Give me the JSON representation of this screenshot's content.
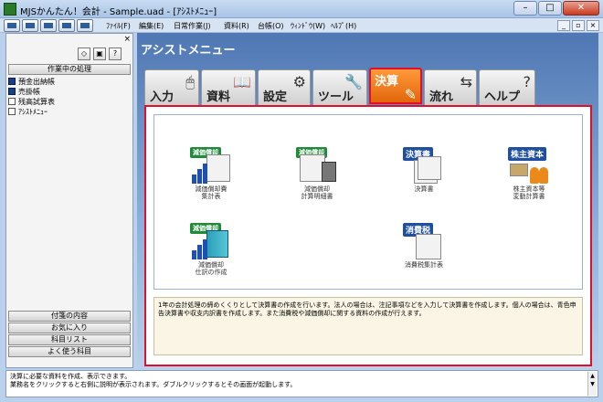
{
  "window": {
    "title": "MJSかんたん！会計 - Sample.uad - [ｱｼｽﾄﾒﾆｭｰ]",
    "minimize": "–",
    "maximize": "□",
    "close": "✕"
  },
  "menubar": {
    "items": [
      "ﾌｧｲﾙ(F)",
      "編集(E)",
      "日常作業(J)",
      "資料(R)",
      "台帳(O)",
      "ｳｨﾝﾄﾞｳ(W)",
      "ﾍﾙﾌﾟ(H)"
    ],
    "mdi": [
      "_",
      "▫",
      "×"
    ]
  },
  "left_pane": {
    "close": "×",
    "icon_buttons": [
      "◇",
      "▣",
      "?"
    ],
    "section_top": "作業中の処理",
    "items": [
      "預金出納帳",
      "売掛帳",
      "残高試算表",
      "ｱｼｽﾄﾒﾆｭｰ"
    ],
    "bottom_sections": [
      "付箋の内容",
      "お気に入り",
      "科目リスト",
      "よく使う科目"
    ]
  },
  "main": {
    "header": "アシストメニュー",
    "tabs": [
      {
        "label": "入力",
        "icon": "mouse-icon"
      },
      {
        "label": "資料",
        "icon": "book-icon"
      },
      {
        "label": "設定",
        "icon": "gear-icon"
      },
      {
        "label": "ツール",
        "icon": "tools-icon"
      },
      {
        "label": "決算",
        "icon": "edit-icon"
      },
      {
        "label": "流れ",
        "icon": "flow-icon"
      },
      {
        "label": "ヘルプ",
        "icon": "help-icon"
      }
    ],
    "active_tab": "決算",
    "icons": [
      {
        "tag": "減価償却",
        "label1": "減価償却費",
        "label2": "集計表"
      },
      {
        "tag": "減価償却",
        "label1": "減価償却",
        "label2": "計算明細書"
      },
      {
        "tag": "決算書",
        "label1": "決算書",
        "label2": ""
      },
      {
        "tag": "株主資本",
        "label1": "株主資本等",
        "label2": "変動計算書"
      },
      {
        "tag": "減価償却",
        "label1": "減価償却",
        "label2": "仕訳の作成"
      },
      {
        "tag": "消費税",
        "label1": "消費税集計表",
        "label2": ""
      }
    ],
    "description": "1年の会計処理の締めくくりとして決算書の作成を行います。法人の場合は、注記事項などを入力して決算書を作成します。個人の場合は、青色申告決算書や収支内訳書を作成します。また消費税や減価償却に関する資料の作成が行えます。"
  },
  "status": {
    "line1": "決算に必要な資料を作成、表示できます。",
    "line2": "業務名をクリックすると右側に説明が表示されます。ダブルクリックするとその画面が起動します。"
  },
  "colors": {
    "active_tab": "#f08020",
    "highlight_border": "#e0102a",
    "header_bg": "#4f77b3"
  }
}
